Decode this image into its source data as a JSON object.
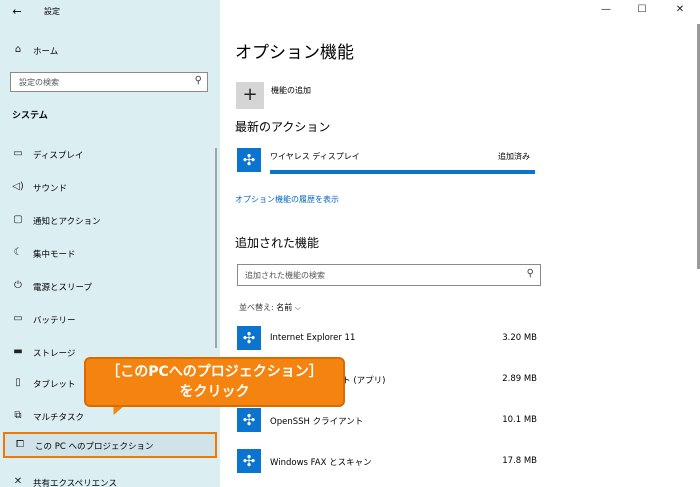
{
  "window": {
    "title": "設定",
    "back_glyph": "←",
    "minimize_glyph": "—",
    "maximize_glyph": "☐",
    "close_glyph": "✕"
  },
  "sidebar": {
    "home": {
      "label": "ホーム",
      "icon": "home-icon",
      "glyph": "⌂"
    },
    "search": {
      "placeholder": "設定の検索",
      "icon": "search-icon",
      "glyph": "⚲"
    },
    "section": "システム",
    "items": [
      {
        "label": "ディスプレイ",
        "icon": "monitor-icon",
        "glyph": "▭"
      },
      {
        "label": "サウンド",
        "icon": "speaker-icon",
        "glyph": "◁)"
      },
      {
        "label": "通知とアクション",
        "icon": "notification-icon",
        "glyph": "▢"
      },
      {
        "label": "集中モード",
        "icon": "moon-icon",
        "glyph": "☾"
      },
      {
        "label": "電源とスリープ",
        "icon": "power-icon",
        "glyph": "⏻"
      },
      {
        "label": "バッテリー",
        "icon": "battery-icon",
        "glyph": "▭"
      },
      {
        "label": "ストレージ",
        "icon": "storage-icon",
        "glyph": "▬"
      },
      {
        "label": "タブレット",
        "icon": "tablet-icon",
        "glyph": "▯"
      },
      {
        "label": "マルチタスク",
        "icon": "multitask-icon",
        "glyph": "⧉"
      },
      {
        "label": "この PC へのプロジェクション",
        "icon": "projection-icon",
        "glyph": "⧠",
        "selected": true
      },
      {
        "label": "共有エクスペリエンス",
        "icon": "shared-icon",
        "glyph": "✕"
      }
    ]
  },
  "main": {
    "title": "オプション機能",
    "add": {
      "label": "機能の追加",
      "glyph": "+"
    },
    "recent": {
      "heading": "最新のアクション",
      "item": {
        "name": "ワイヤレス ディスプレイ",
        "status": "追加済み",
        "progress": 1.0
      }
    },
    "history_link": "オプション機能の履歴を表示",
    "installed": {
      "heading": "追加された機能",
      "search_placeholder": "追加された機能の検索",
      "sort_label": "並べ替え:",
      "sort_value": "名前",
      "sort_glyph": "⌵",
      "features": [
        {
          "name": "Internet Explorer 11",
          "size": "3.20 MB"
        },
        {
          "name": "アシスト (アプリ)",
          "size": "2.89 MB"
        },
        {
          "name": "OpenSSH クライアント",
          "size": "10.1 MB"
        },
        {
          "name": "Windows FAX とスキャン",
          "size": "17.8 MB"
        }
      ]
    }
  },
  "callout": {
    "line1": "［このPCへのプロジェクション］",
    "line2": "をクリック"
  },
  "colors": {
    "accent": "#0a74cf",
    "sidebar": "#dbeef2",
    "callout": "#f5830f"
  }
}
